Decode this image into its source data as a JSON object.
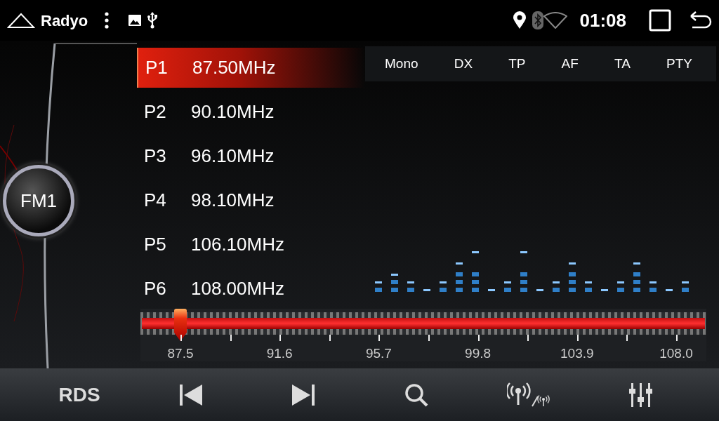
{
  "status_bar": {
    "app_title": "Radyo",
    "time": "01:08"
  },
  "band": {
    "label": "FM1"
  },
  "presets": [
    {
      "number": "P1",
      "frequency": "87.50MHz",
      "selected": true
    },
    {
      "number": "P2",
      "frequency": "90.10MHz",
      "selected": false
    },
    {
      "number": "P3",
      "frequency": "96.10MHz",
      "selected": false
    },
    {
      "number": "P4",
      "frequency": "98.10MHz",
      "selected": false
    },
    {
      "number": "P5",
      "frequency": "106.10MHz",
      "selected": false
    },
    {
      "number": "P6",
      "frequency": "108.00MHz",
      "selected": false
    }
  ],
  "rds_flags": [
    "Mono",
    "DX",
    "TP",
    "AF",
    "TA",
    "PTY"
  ],
  "tuner": {
    "level": 0.071,
    "scale_labels": [
      "87.5",
      "91.6",
      "95.7",
      "99.8",
      "103.9",
      "108.0"
    ]
  },
  "bottom_bar": [
    {
      "kind": "text",
      "label": "RDS"
    },
    {
      "kind": "prev"
    },
    {
      "kind": "next"
    },
    {
      "kind": "search"
    },
    {
      "kind": "antenna"
    },
    {
      "kind": "equalizer"
    }
  ]
}
